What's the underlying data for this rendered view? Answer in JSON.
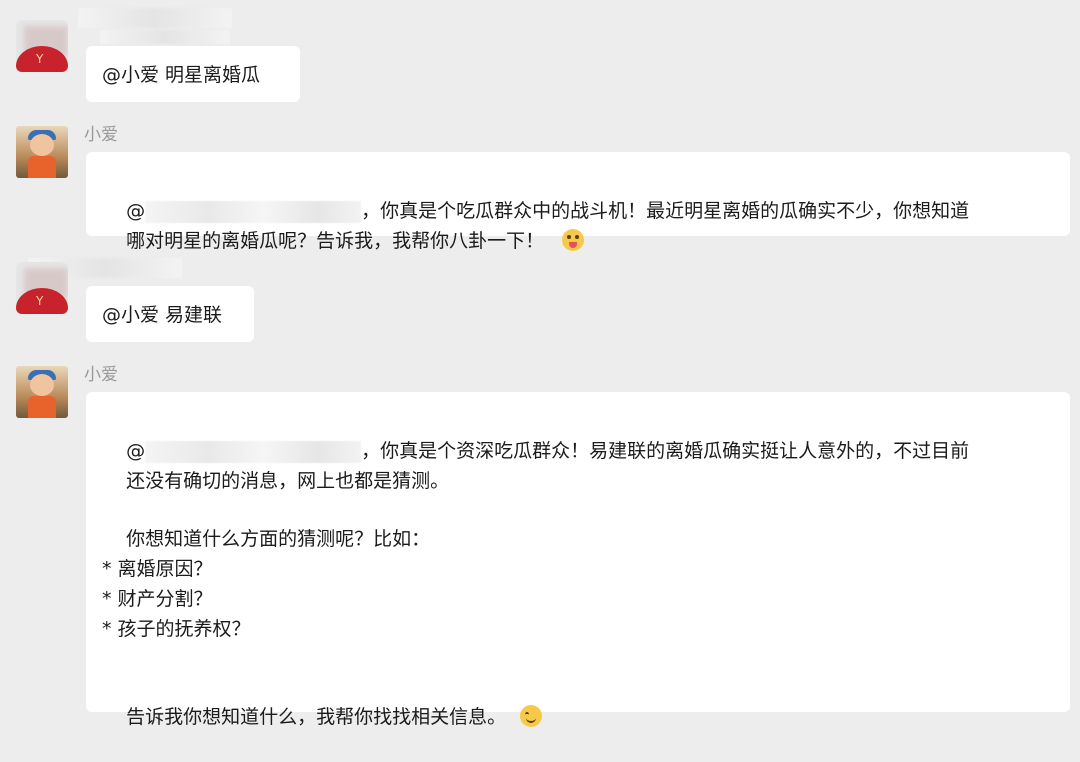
{
  "messages": [
    {
      "sender": "user",
      "text": "@小爱 明星离婚瓜"
    },
    {
      "sender": "bot",
      "name": "小爱",
      "line1_prefix": "@",
      "line1_suffix": "，你真是个吃瓜群众中的战斗机！最近明星离婚的瓜确实不少，你想知道",
      "line2": "哪对明星的离婚瓜呢？告诉我，我帮你八卦一下！",
      "emoji": "squinting-tongue-emoji"
    },
    {
      "sender": "user",
      "text": "@小爱 易建联"
    },
    {
      "sender": "bot",
      "name": "小爱",
      "line1_prefix": "@",
      "line1_suffix": "，你真是个资深吃瓜群众！易建联的离婚瓜确实挺让人意外的，不过目前",
      "line2": "还没有确切的消息，网上也都是猜测。",
      "line3": "你想知道什么方面的猜测呢？比如：",
      "bullets": [
        "* 离婚原因？",
        "* 财产分割？",
        "* 孩子的抚养权？"
      ],
      "line_last": "告诉我你想知道什么，我帮你找找相关信息。",
      "emoji": "smiling-emoji"
    }
  ]
}
